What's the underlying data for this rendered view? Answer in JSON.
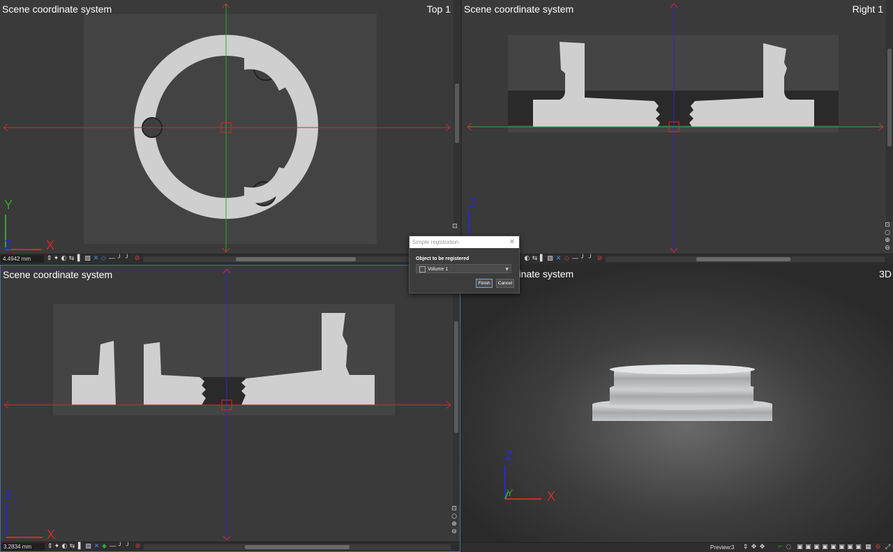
{
  "viewports": {
    "top": {
      "title": "Scene coordinate system",
      "label": "Top 1",
      "scale": "4.4942 mm"
    },
    "right": {
      "title": "Scene coordinate system",
      "label": "Right 1"
    },
    "front": {
      "title": "Scene coordinate system",
      "scale": "3.2834 mm"
    },
    "view3d": {
      "title": "Scene coordinate system",
      "label": "3D"
    }
  },
  "axes": {
    "x": "X",
    "y": "Y",
    "z": "Z"
  },
  "dialog": {
    "title": "Simple registration",
    "close_glyph": "✕",
    "field_label": "Object to be registered",
    "selected_object": "Volume 1",
    "finish_label": "Finish",
    "cancel_label": "Cancel"
  },
  "preview": {
    "label": "Preview:",
    "value": "3"
  },
  "colors": {
    "crosshair_red": "#d42a2a",
    "axis_green": "#2fa82f",
    "axis_blue": "#2828d8",
    "background": "#3a3a3a"
  },
  "icons": [
    "zoom-icon",
    "contrast-icon",
    "transform-icon",
    "sparkle-icon",
    "pan-icon",
    "zoom-in-icon",
    "zoom-out-icon"
  ]
}
